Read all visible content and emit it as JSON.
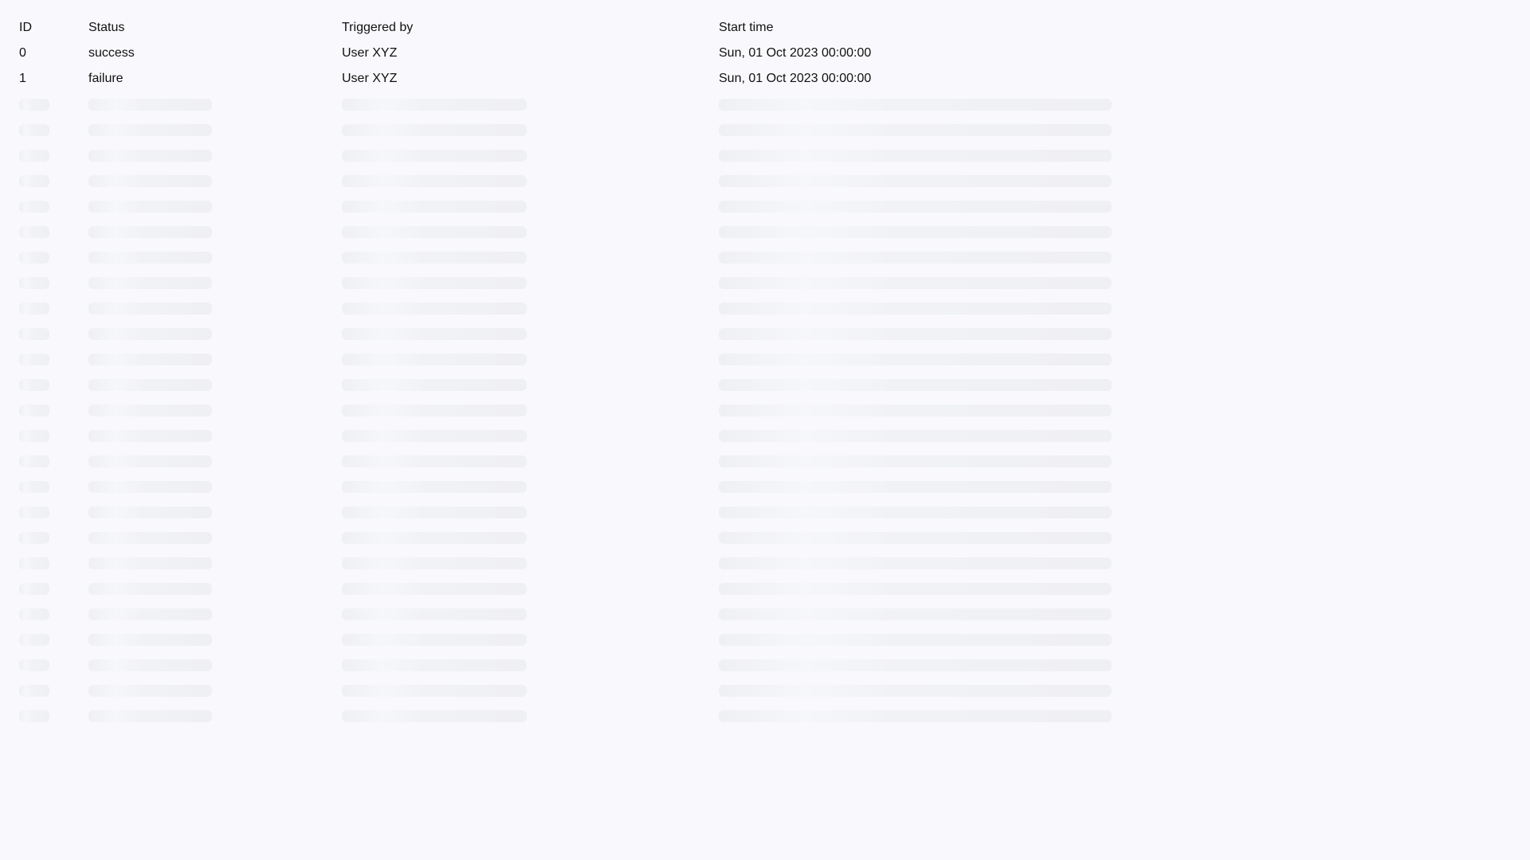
{
  "table": {
    "columns": [
      "ID",
      "Status",
      "Triggered by",
      "Start time"
    ],
    "rows": [
      {
        "id": "0",
        "status": "success",
        "triggered_by": "User XYZ",
        "start_time": "Sun, 01 Oct 2023 00:00:00"
      },
      {
        "id": "1",
        "status": "failure",
        "triggered_by": "User XYZ",
        "start_time": "Sun, 01 Oct 2023 00:00:00"
      }
    ],
    "loading_placeholder_rows": 25
  }
}
